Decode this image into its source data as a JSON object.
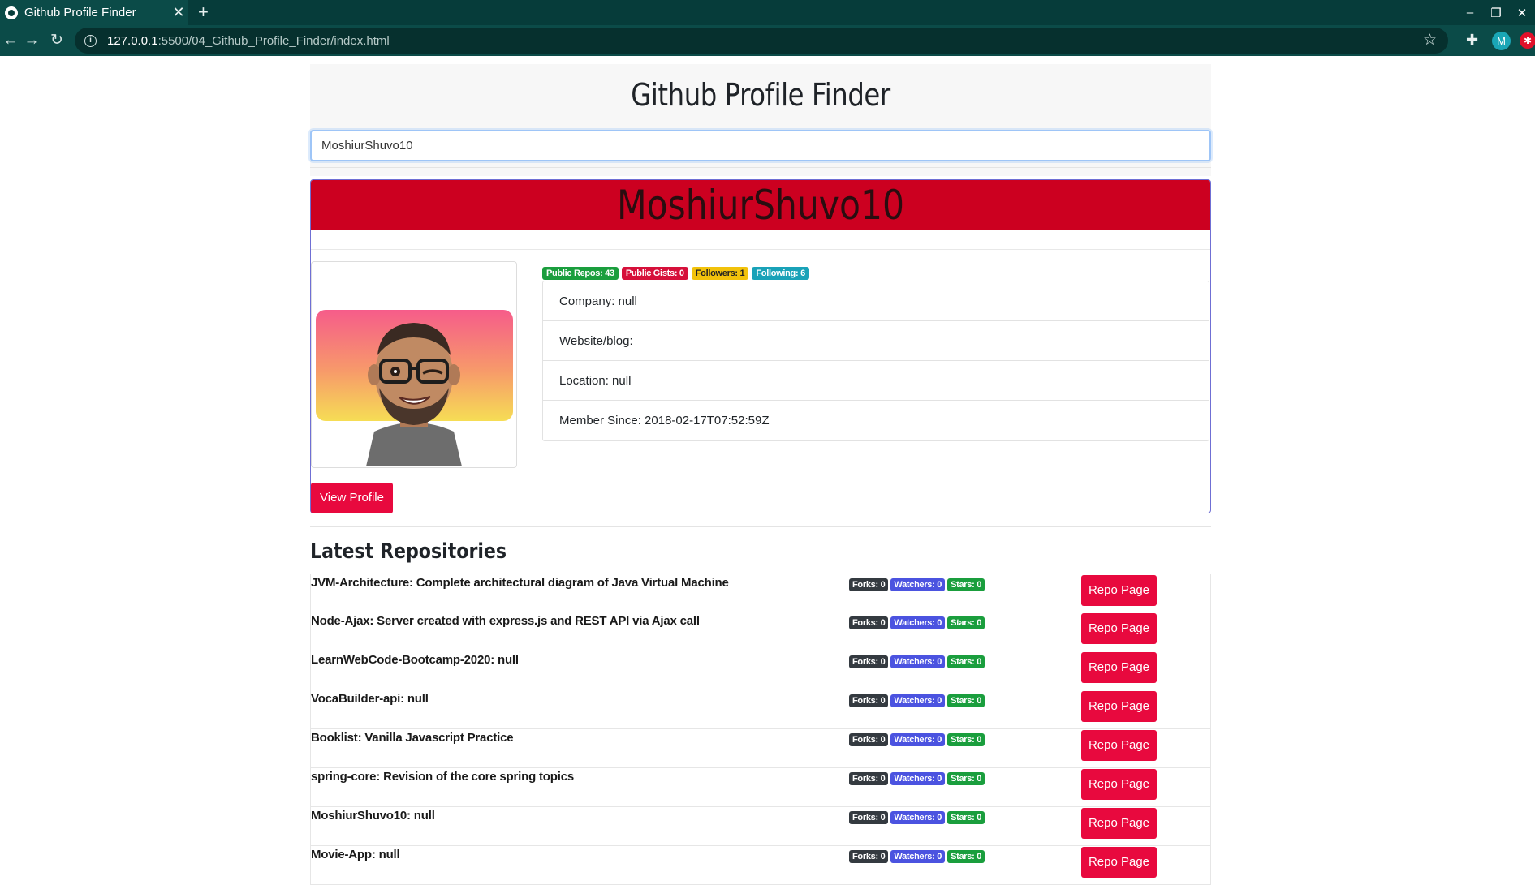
{
  "browser": {
    "tab_title": "Github Profile Finder",
    "tab_close": "✕",
    "new_tab": "+",
    "url_host": "127.0.0.1",
    "url_path": ":5500/04_Github_Profile_Finder/index.html",
    "profile_initial": "M",
    "window_controls": [
      "–",
      "❐",
      "✕"
    ]
  },
  "app": {
    "title": "Github Profile Finder",
    "search_value": "MoshiurShuvo10"
  },
  "profile": {
    "name": "MoshiurShuvo10",
    "badges": {
      "public_repos": "Public Repos: 43",
      "public_gists": "Public Gists: 0",
      "followers": "Followers: 1",
      "following": "Following: 6"
    },
    "info": {
      "company": "Company: null",
      "website": "Website/blog:",
      "location": "Location: null",
      "member_since": "Member Since: 2018-02-17T07:52:59Z"
    },
    "view_profile_label": "View Profile"
  },
  "repos": {
    "heading": "Latest Repositories",
    "button_label": "Repo Page",
    "items": [
      {
        "name": "JVM-Architecture: Complete architectural diagram of Java Virtual Machine",
        "forks": "Forks: 0",
        "watchers": "Watchers: 0",
        "stars": "Stars: 0"
      },
      {
        "name": "Node-Ajax: Server created with express.js and REST API via Ajax call",
        "forks": "Forks: 0",
        "watchers": "Watchers: 0",
        "stars": "Stars: 0"
      },
      {
        "name": "LearnWebCode-Bootcamp-2020: null",
        "forks": "Forks: 0",
        "watchers": "Watchers: 0",
        "stars": "Stars: 0"
      },
      {
        "name": "VocaBuilder-api: null",
        "forks": "Forks: 0",
        "watchers": "Watchers: 0",
        "stars": "Stars: 0"
      },
      {
        "name": "Booklist: Vanilla Javascript Practice",
        "forks": "Forks: 0",
        "watchers": "Watchers: 0",
        "stars": "Stars: 0"
      },
      {
        "name": "spring-core: Revision of the core spring topics",
        "forks": "Forks: 0",
        "watchers": "Watchers: 0",
        "stars": "Stars: 0"
      },
      {
        "name": "MoshiurShuvo10: null",
        "forks": "Forks: 0",
        "watchers": "Watchers: 0",
        "stars": "Stars: 0"
      },
      {
        "name": "Movie-App: null",
        "forks": "Forks: 0",
        "watchers": "Watchers: 0",
        "stars": "Stars: 0"
      }
    ]
  },
  "colors": {
    "header_red": "#cc0020",
    "button_red": "#e8093e",
    "browser_teal": "#0b4b48",
    "badge_green": "#1a9e3d",
    "badge_blue": "#4b53e0",
    "badge_yellow": "#f2c20b",
    "badge_teal": "#19a2b8"
  }
}
